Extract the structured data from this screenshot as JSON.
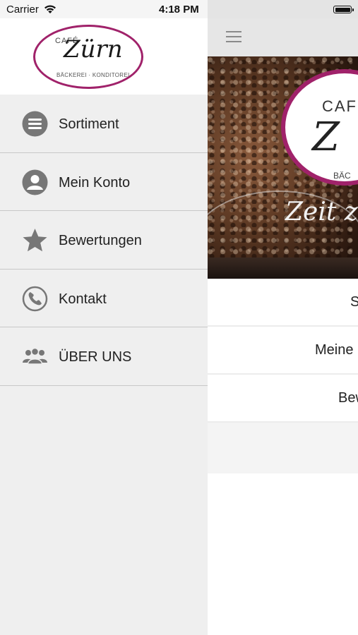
{
  "status_bar": {
    "carrier": "Carrier",
    "time": "4:18 PM"
  },
  "drawer": {
    "logo": {
      "cafe": "CAFÉ",
      "name": "Zürn",
      "subtitle": "BÄCKEREI · KONDITOREI"
    },
    "menu": [
      {
        "label": "Sortiment",
        "icon": "list-icon"
      },
      {
        "label": "Mein Konto",
        "icon": "user-icon"
      },
      {
        "label": "Bewertungen",
        "icon": "star-icon"
      },
      {
        "label": "Kontakt",
        "icon": "phone-icon"
      },
      {
        "label": "ÜBER UNS",
        "icon": "group-icon"
      }
    ]
  },
  "background_app": {
    "hero": {
      "logo_cafe": "CAF",
      "logo_name": "Z",
      "logo_sub": "BÄC",
      "slogan": "Zeit z"
    },
    "rows": [
      "S",
      "Meine",
      "Bew"
    ]
  },
  "colors": {
    "brand_magenta": "#a0226a",
    "icon_gray": "#777777",
    "drawer_bg": "#efefef"
  }
}
